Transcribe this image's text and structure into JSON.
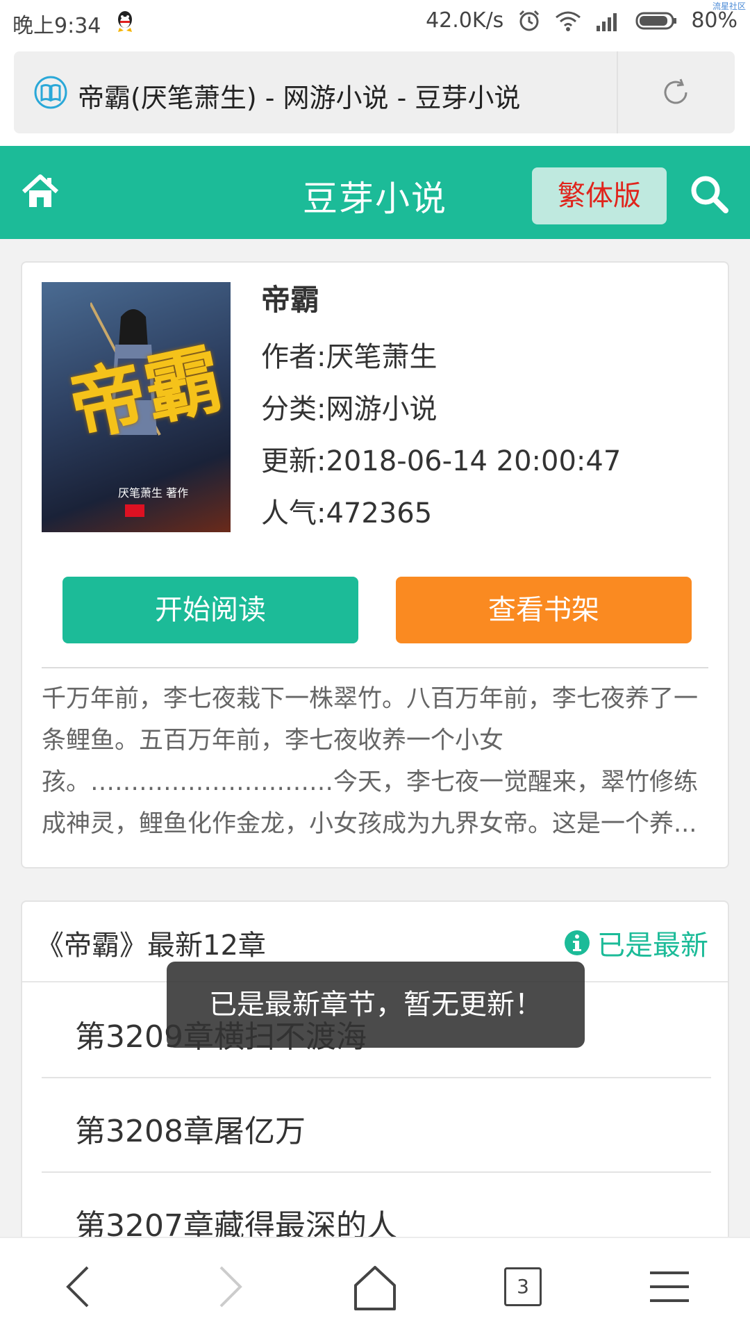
{
  "status_bar": {
    "time": "晚上9:34",
    "speed": "42.0K/s",
    "battery": "80%",
    "corner_label": "流星社区"
  },
  "address_bar": {
    "page_title": "帝霸(厌笔萧生) - 网游小说 - 豆芽小说"
  },
  "header": {
    "site_name": "豆芽小说",
    "traditional_label": "繁体版"
  },
  "book": {
    "name": "帝霸",
    "cover_text": "帝霸",
    "cover_subtext": "厌笔萧生 著作",
    "author_label": "作者:",
    "author": "厌笔萧生",
    "category_label": "分类:",
    "category": "网游小说",
    "updated_label": "更新:",
    "updated": "2018-06-14 20:00:47",
    "popularity_label": "人气:",
    "popularity": "472365",
    "read_button": "开始阅读",
    "shelf_button": "查看书架",
    "description": "千万年前，李七夜栽下一株翠竹。八百万年前，李七夜养了一条鲤鱼。五百万年前，李七夜收养一个小女孩。…………………………今天，李七夜一觉醒来，翠竹修练成神灵，鲤鱼化作金龙，小女孩成为九界女帝。这是一个养..."
  },
  "chapters": {
    "header": "《帝霸》最新12章",
    "latest_label": "已是最新",
    "items": [
      {
        "title": "第3209章横扫不渡海"
      },
      {
        "title": "第3208章屠亿万"
      },
      {
        "title": "第3207章藏得最深的人"
      }
    ]
  },
  "toast": {
    "message": "已是最新章节，暂无更新！"
  },
  "bottom_nav": {
    "tab_count": "3"
  },
  "colors": {
    "accent": "#1cbb98",
    "orange": "#fa8a21",
    "traditional_text": "#e0241c"
  }
}
